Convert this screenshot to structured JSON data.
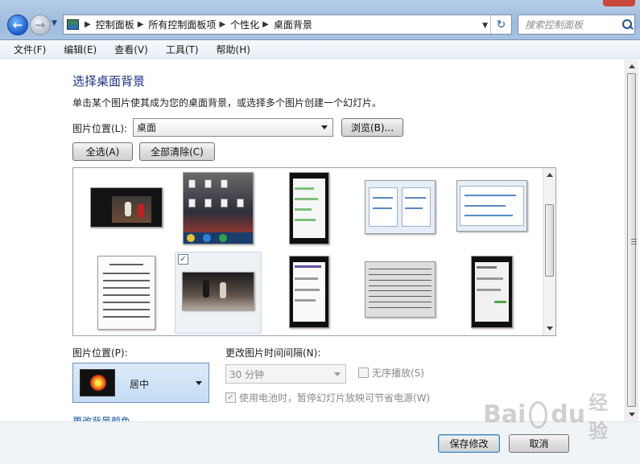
{
  "address_bar": {
    "breadcrumbs": [
      "控制面板",
      "所有控制面板项",
      "个性化",
      "桌面背景"
    ],
    "search_placeholder": "搜索控制面板"
  },
  "menu": [
    "文件(F)",
    "编辑(E)",
    "查看(V)",
    "工具(T)",
    "帮助(H)"
  ],
  "page": {
    "title": "选择桌面背景",
    "description": "单击某个图片使其成为您的桌面背景，或选择多个图片创建一个幻灯片。",
    "location_label": "图片位置(L):",
    "location_value": "桌面",
    "browse_label": "浏览(B)...",
    "select_all_label": "全选(A)",
    "clear_all_label": "全部清除(C)"
  },
  "gallery": {
    "selected_index": 6,
    "scroll_position": 0.35
  },
  "options": {
    "position_label": "图片位置(P):",
    "position_value": "居中",
    "interval_label": "更改图片时间间隔(N):",
    "interval_value": "30 分钟",
    "shuffle_label": "无序播放(S)",
    "shuffle_checked": false,
    "battery_label": "使用电池时，暂停幻灯片放映可节省电源(W)",
    "battery_checked": true,
    "change_color_link": "更改背景颜色"
  },
  "footer": {
    "save_label": "保存修改",
    "cancel_label": "取消"
  },
  "watermark": {
    "text_left": "Bai",
    "text_right": "du",
    "text_cn": "经验"
  }
}
